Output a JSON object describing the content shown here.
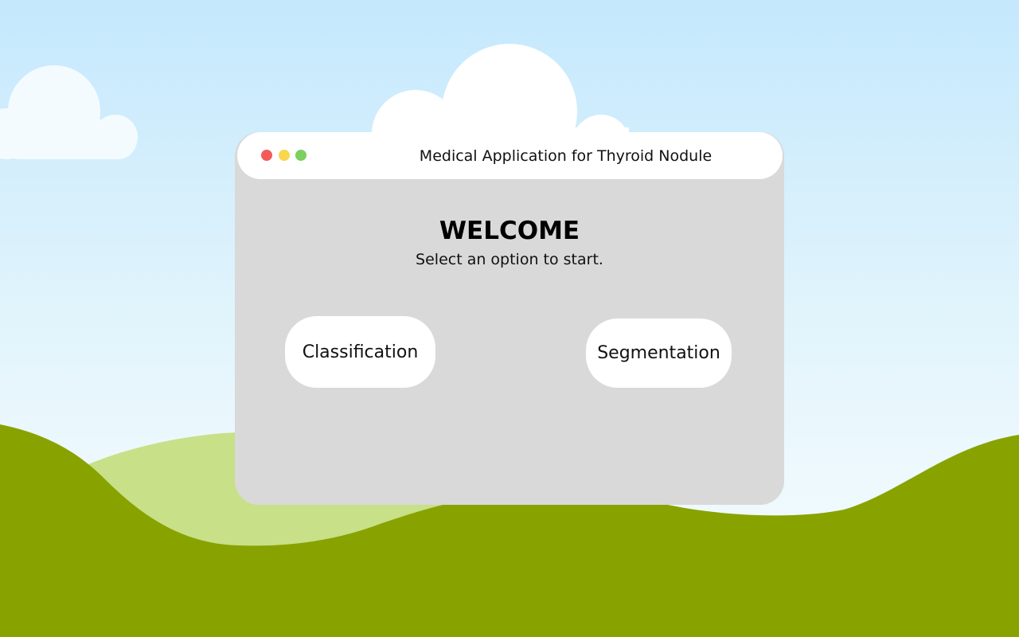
{
  "window": {
    "title": "Medical Application for Thyroid Nodule",
    "controls": {
      "close_color": "#f35b5b",
      "minimize_color": "#f8d64e",
      "maximize_color": "#7bd05e"
    }
  },
  "main": {
    "heading": "WELCOME",
    "subtitle": "Select an option to start.",
    "buttons": [
      {
        "label": "Classification"
      },
      {
        "label": "Segmentation"
      }
    ]
  },
  "colors": {
    "sky": "#c5e8fd",
    "window_body": "#d9d9d9",
    "title_bar": "#ffffff",
    "hill_dark": "#88a300",
    "hill_light": "#c8e087"
  }
}
